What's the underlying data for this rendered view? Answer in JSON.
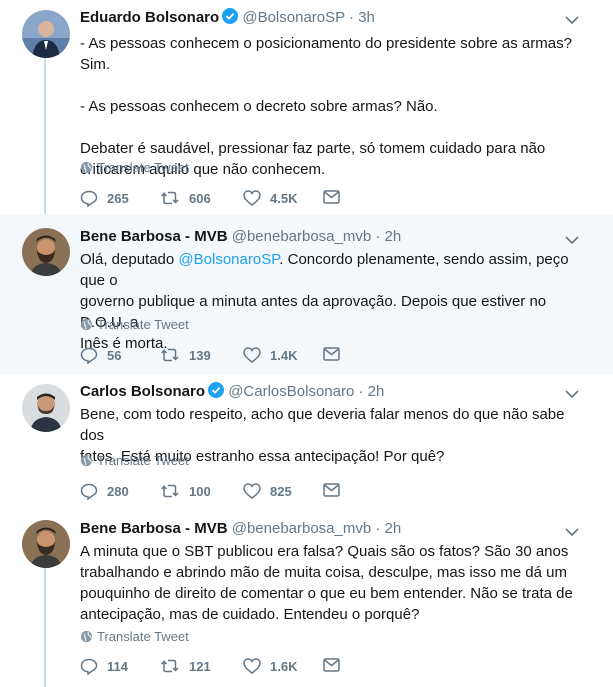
{
  "tweets": [
    {
      "name": "Eduardo Bolsonaro",
      "verified": true,
      "handle": "@BolsonaroSP",
      "time": "· 3h",
      "lines": [
        "- As pessoas conhecem o posicionamento do presidente sobre as armas? Sim.",
        "",
        "- As pessoas conhecem o decreto sobre armas? Não.",
        "",
        "Debater é saudável, pressionar faz parte, só tomem cuidado para não",
        "criticarem aquilo que não conhecem."
      ],
      "translate": "Translate Tweet",
      "replies": "265",
      "retweets": "606",
      "likes": "4.5K"
    },
    {
      "name": "Bene Barbosa - MVB",
      "verified": false,
      "handle": "@benebarbosa_mvb",
      "time": "· 2h",
      "text_prefix": "Olá, deputado ",
      "mention": "@BolsonaroSP",
      "text_rest": ". Concordo plenamente, sendo assim, peço que o",
      "lines": [
        "governo publique a minuta antes da aprovação. Depois que estiver no D.O.U. a",
        "Inês é morta."
      ],
      "translate": "Translate Tweet",
      "replies": "56",
      "retweets": "139",
      "likes": "1.4K"
    },
    {
      "name": "Carlos Bolsonaro",
      "verified": true,
      "handle": "@CarlosBolsonaro",
      "time": "· 2h",
      "lines": [
        "Bene, com todo respeito, acho que deveria falar menos do que não sabe dos",
        "fatos. Está muito estranho essa antecipação! Por quê?"
      ],
      "translate": "Translate Tweet",
      "replies": "280",
      "retweets": "100",
      "likes": "825"
    },
    {
      "name": "Bene Barbosa - MVB",
      "verified": false,
      "handle": "@benebarbosa_mvb",
      "time": "· 2h",
      "lines": [
        "A minuta que o SBT publicou era falsa? Quais são os fatos? São 30 anos",
        "trabalhando e abrindo mão de muita coisa, desculpe, mas isso me dá um",
        "pouquinho de direito de comentar o que eu bem entender. Não se trata de",
        "antecipação, mas de cuidado. Entendeu o porquê?"
      ],
      "translate": "Translate Tweet",
      "replies": "114",
      "retweets": "121",
      "likes": "1.6K"
    }
  ],
  "colors": {
    "accent": "#1da1f2",
    "thread_line": "#c4d9ec",
    "muted": "#657786",
    "highlight_bg": "#f5f8fa"
  },
  "icons": [
    "verified-badge-icon",
    "chevron-down-icon",
    "globe-icon",
    "reply-icon",
    "retweet-icon",
    "like-icon",
    "message-icon"
  ]
}
